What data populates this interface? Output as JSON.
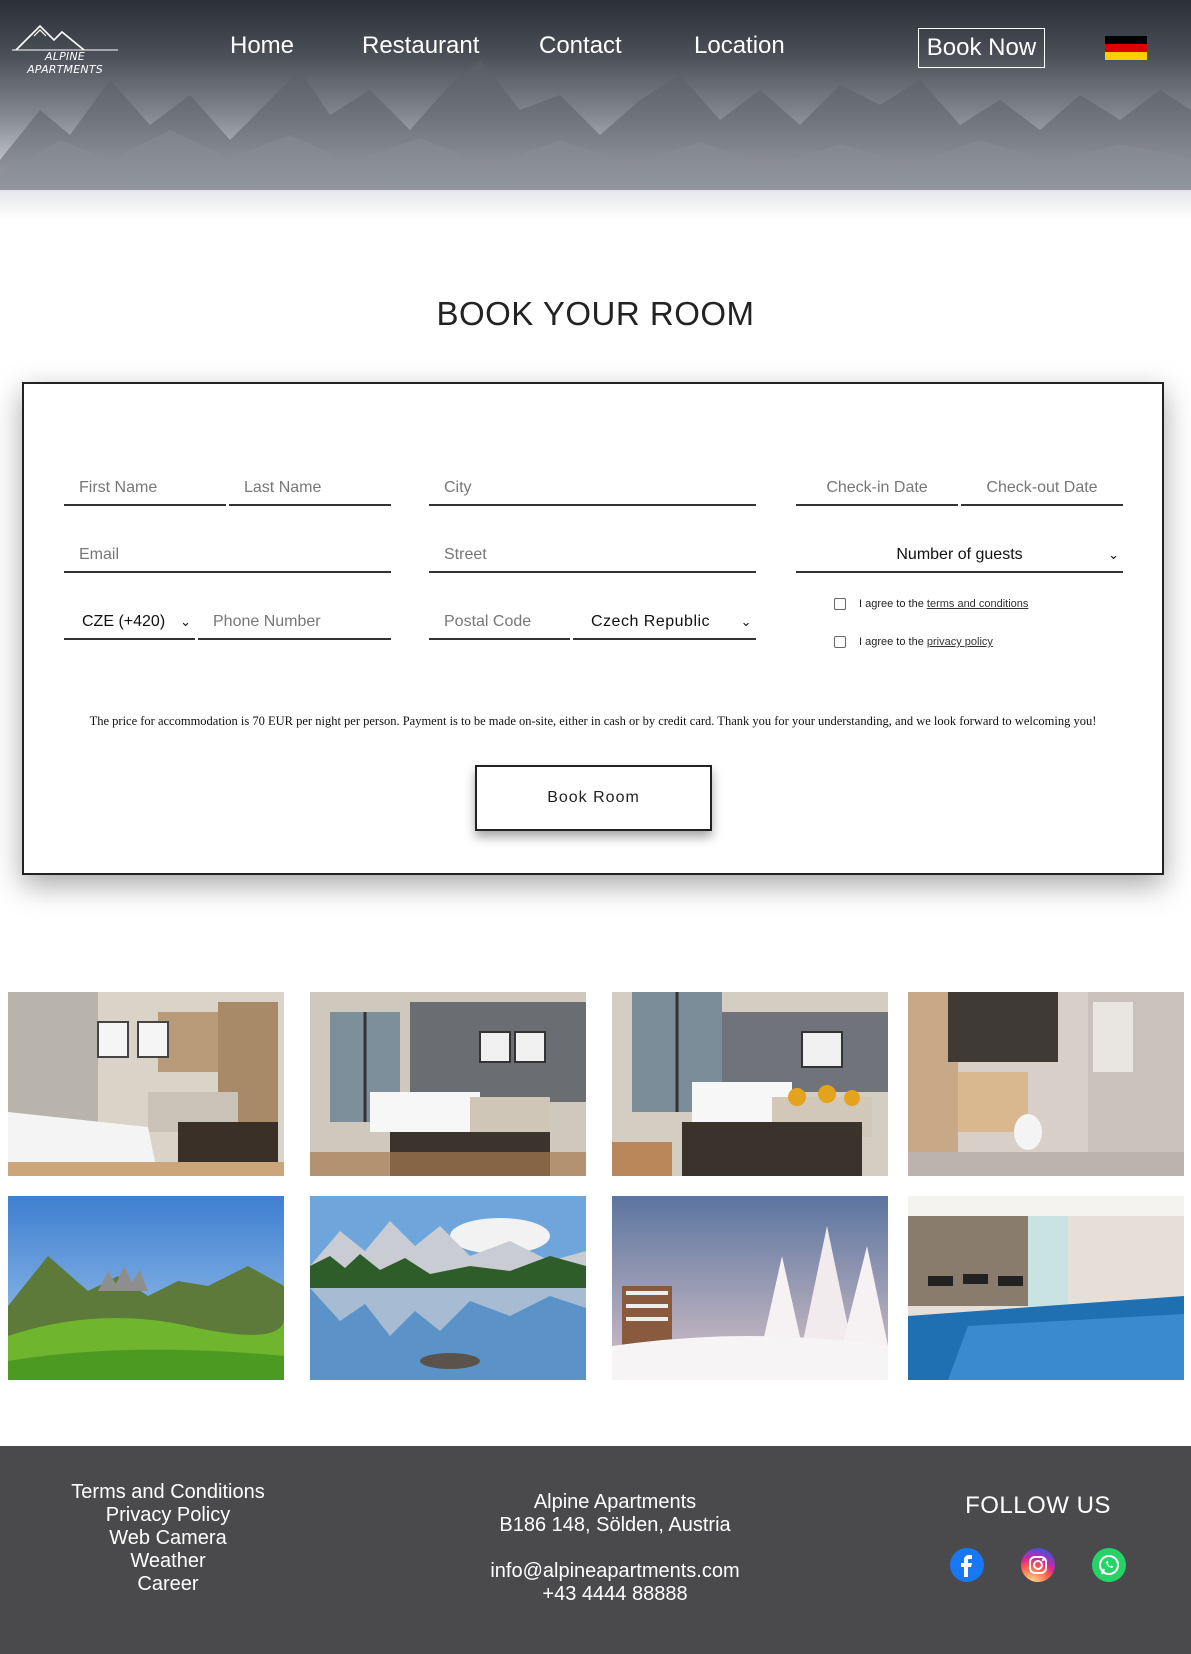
{
  "brand": {
    "logo_text": "ALPINE APARTMENTS"
  },
  "nav": {
    "items": [
      {
        "label": "Home"
      },
      {
        "label": "Restaurant"
      },
      {
        "label": "Contact"
      },
      {
        "label": "Location"
      }
    ],
    "book_now": "Book Now",
    "language_flag": "german-flag"
  },
  "page_title": "BOOK YOUR ROOM",
  "form": {
    "first_name_placeholder": "First Name",
    "last_name_placeholder": "Last Name",
    "city_placeholder": "City",
    "checkin_placeholder": "Check-in Date",
    "checkout_placeholder": "Check-out Date",
    "email_placeholder": "Email",
    "street_placeholder": "Street",
    "guests_selected": "Number of guests",
    "phone_code_selected": "CZE (+420)",
    "phone_placeholder": "Phone Number",
    "postal_placeholder": "Postal Code",
    "country_selected": "Czech Republic",
    "agree_terms_prefix": "I agree to the ",
    "agree_terms_link": "terms and conditions",
    "agree_privacy_prefix": "I agree to the ",
    "agree_privacy_link": "privacy policy",
    "price_note": "The price for accommodation is 70 EUR per night per person. Payment is to be made on-site, either in cash or by credit card. Thank you for your understanding, and we look forward to welcoming you!",
    "submit_label": "Book Room"
  },
  "gallery": [
    {
      "name": "living-room-photo"
    },
    {
      "name": "bedroom-photo"
    },
    {
      "name": "suite-photo"
    },
    {
      "name": "bathroom-photo"
    },
    {
      "name": "alpine-valley-photo"
    },
    {
      "name": "mountain-lake-photo"
    },
    {
      "name": "winter-hotel-photo"
    },
    {
      "name": "indoor-pool-photo"
    }
  ],
  "footer": {
    "links": [
      "Terms and Conditions",
      "Privacy Policy",
      "Web Camera",
      "Weather",
      "Career"
    ],
    "company": "Alpine Apartments",
    "address": "B186 148, Sölden, Austria",
    "email": "info@alpineapartments.com",
    "phone": "+43 4444 88888",
    "follow_title": "FOLLOW US",
    "social": [
      "facebook-icon",
      "instagram-icon",
      "whatsapp-icon"
    ]
  },
  "colors": {
    "footer_bg": "#4a4a4c",
    "facebook": "#1877f2",
    "instagram": "#e1306c",
    "whatsapp": "#25d366"
  }
}
